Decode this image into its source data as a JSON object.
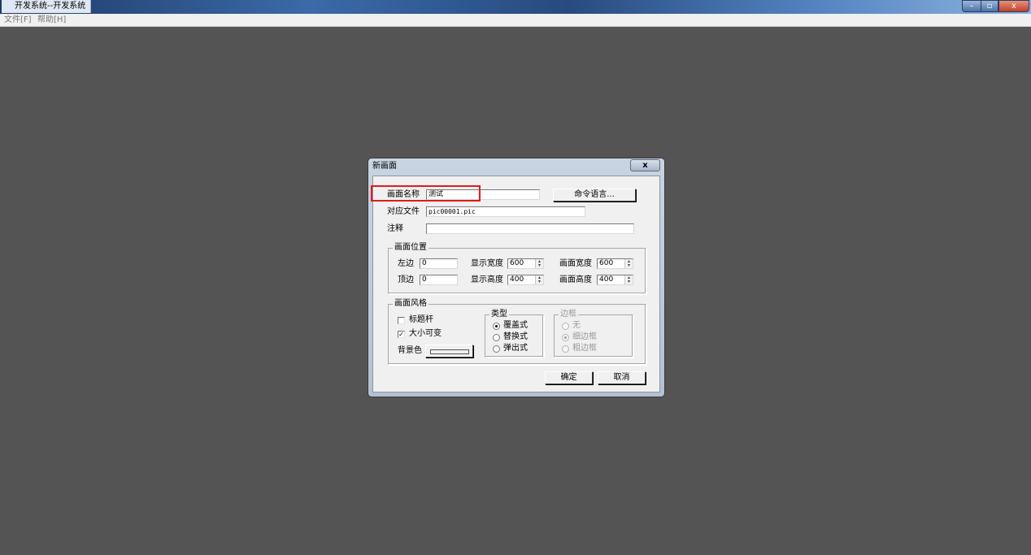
{
  "window": {
    "title": "开发系统--开发系统",
    "min_glyph": "–",
    "max_glyph": "▫",
    "close_glyph": "x"
  },
  "menu": {
    "file": "文件[F]",
    "help": "帮助[H]"
  },
  "dialog": {
    "title": "新画面",
    "close_glyph": "x",
    "name_label": "画面名称",
    "name_value": "测试",
    "command_button": "命令语言...",
    "file_label": "对应文件",
    "file_value": "pic00001.pic",
    "comment_label": "注释",
    "comment_value": "",
    "position": {
      "title": "画面位置",
      "left_label": "左边",
      "left_value": "0",
      "top_label": "顶边",
      "top_value": "0",
      "disp_width_label": "显示宽度",
      "disp_width_value": "600",
      "disp_height_label": "显示高度",
      "disp_height_value": "400",
      "pic_width_label": "画面宽度",
      "pic_width_value": "600",
      "pic_height_label": "画面高度",
      "pic_height_value": "400"
    },
    "style": {
      "title": "画面风格",
      "titlebar_label": "标题杆",
      "titlebar_checked": false,
      "resizable_label": "大小可变",
      "resizable_checked": true,
      "bgcolor_label": "背景色",
      "type": {
        "title": "类型",
        "options": [
          "覆盖式",
          "替换式",
          "弹出式"
        ],
        "selected": "覆盖式"
      },
      "border": {
        "title": "边框",
        "options": [
          "无",
          "细边框",
          "粗边框"
        ],
        "selected": "细边框",
        "disabled": true
      }
    },
    "ok_button": "确定",
    "cancel_button": "取消"
  },
  "colors": {
    "desktop": "#545454",
    "dialog_face": "#f0f0f0",
    "highlight_box": "#e01b1b"
  }
}
